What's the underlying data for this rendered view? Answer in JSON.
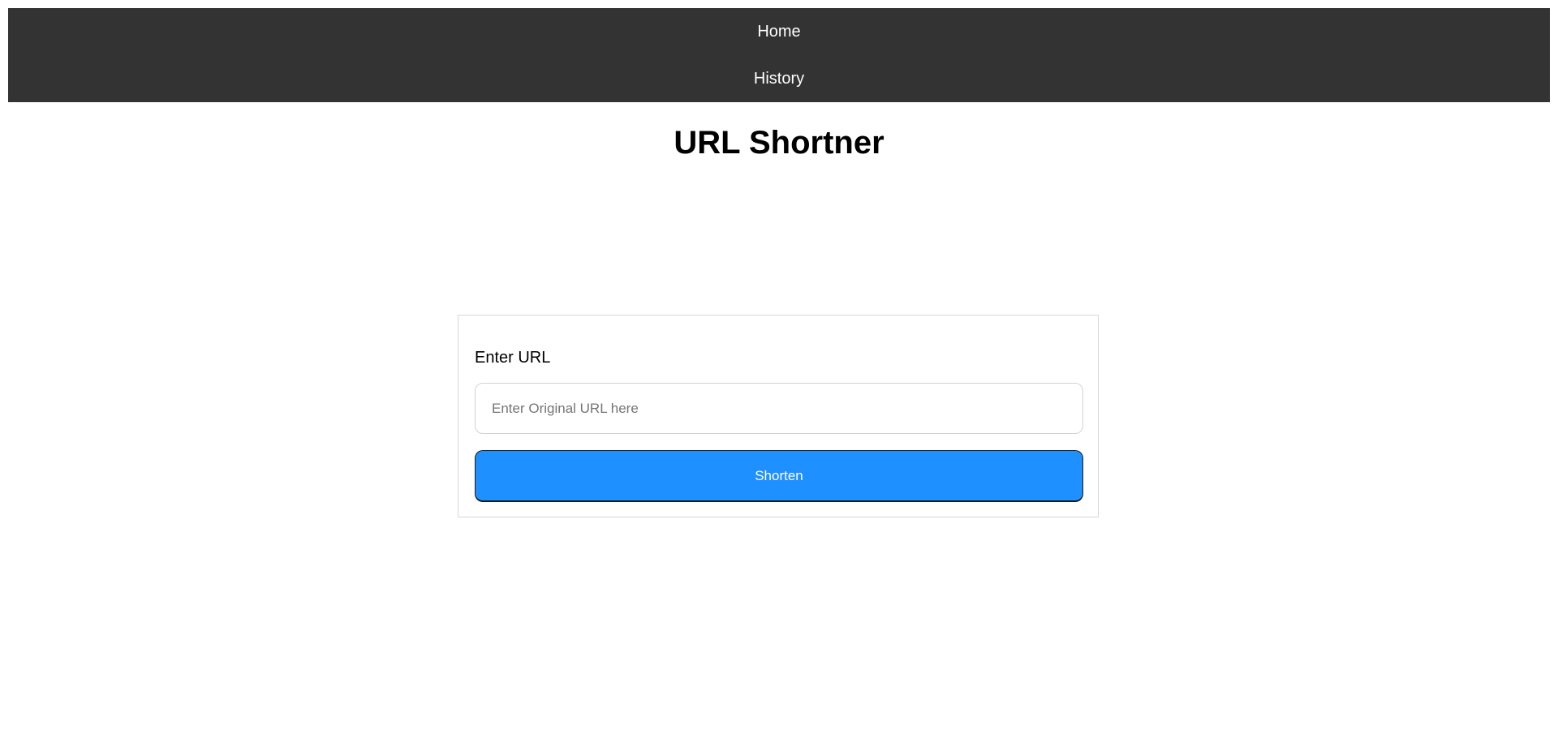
{
  "nav": {
    "items": [
      {
        "label": "Home"
      },
      {
        "label": "History"
      }
    ]
  },
  "page": {
    "title": "URL Shortner"
  },
  "form": {
    "label": "Enter URL",
    "input_value": "",
    "input_placeholder": "Enter Original URL here",
    "submit_label": "Shorten"
  },
  "colors": {
    "navbar_bg": "#333333",
    "button_bg": "#1e90ff",
    "card_border": "#d6d6d6"
  }
}
